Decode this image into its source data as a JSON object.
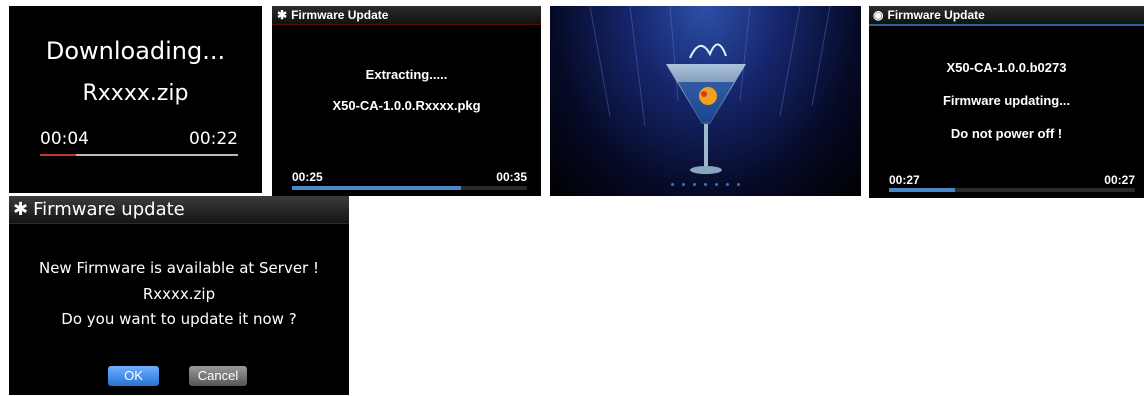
{
  "downloading": {
    "status": "Downloading...",
    "filename": "Rxxxx.zip",
    "elapsed": "00:04",
    "total": "00:22",
    "progress": 0.18,
    "accent": "#c0392b"
  },
  "extracting": {
    "title": "Firmware Update",
    "status": "Extracting.....",
    "filename": "X50-CA-1.0.0.Rxxxx.pkg",
    "elapsed": "00:25",
    "total": "00:35",
    "progress": 0.72,
    "accent": "#4a86c8"
  },
  "splash": {
    "dot_count": 7,
    "dot_color": "#3b6fcf"
  },
  "updating": {
    "title": "Firmware Update",
    "version": "X50-CA-1.0.0.b0273",
    "status": "Firmware updating...",
    "warning": "Do not power off !",
    "elapsed": "00:27",
    "total": "00:27",
    "progress": 0.27,
    "accent": "#4a86c8"
  },
  "dialog": {
    "title": "Firmware update",
    "line1": "New Firmware is available at Server !",
    "filename": "Rxxxx.zip",
    "question": "Do you want to update it now ?",
    "ok_label": "OK",
    "cancel_label": "Cancel"
  }
}
